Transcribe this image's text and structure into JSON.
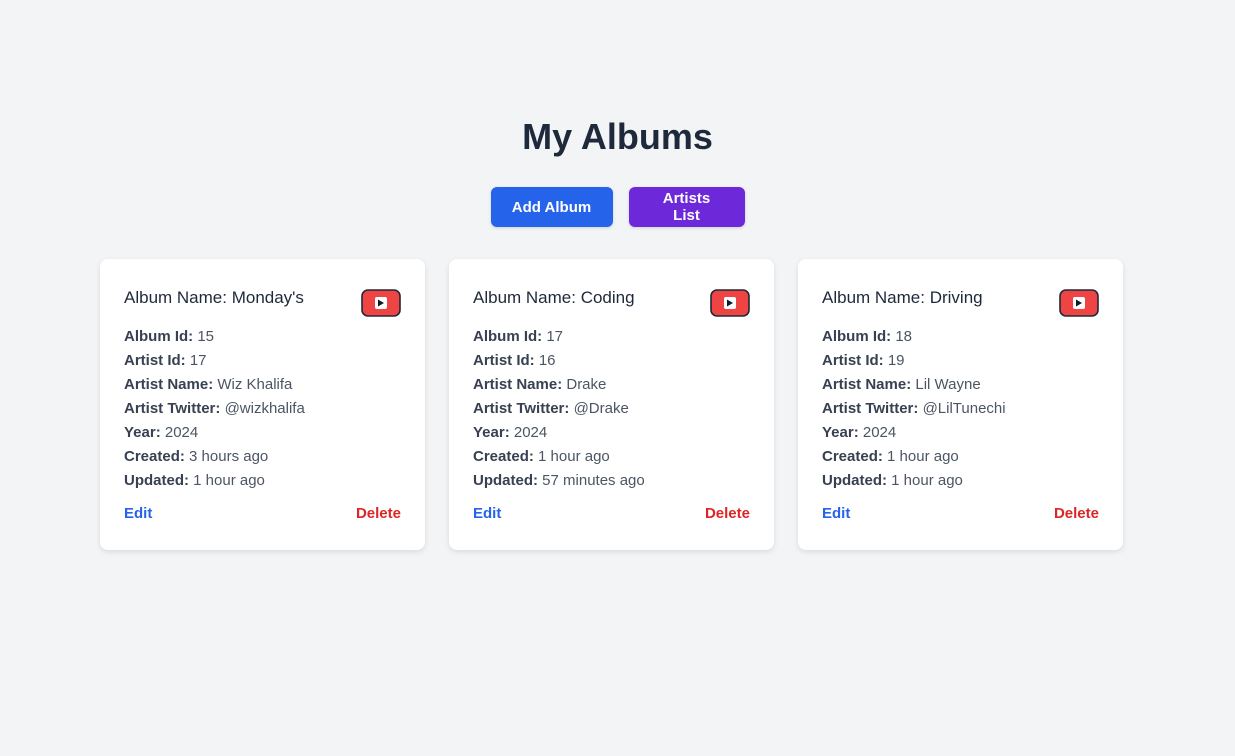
{
  "header": {
    "title": "My Albums",
    "add_album_label": "Add Album",
    "artists_list_label": "Artists List"
  },
  "labels": {
    "album_name": "Album Name: ",
    "album_id": "Album Id:",
    "artist_id": "Artist Id:",
    "artist_name": "Artist Name:",
    "artist_twitter": "Artist Twitter:",
    "year": "Year:",
    "created": "Created:",
    "updated": "Updated:",
    "edit": "Edit",
    "delete": "Delete"
  },
  "icons": {
    "play": "youtube-icon"
  },
  "colors": {
    "add_button": "#2563eb",
    "artists_button": "#6d28d9",
    "edit_link": "#2563eb",
    "delete_link": "#dc2626",
    "youtube_red": "#ef4444"
  },
  "albums": [
    {
      "name": "Monday's",
      "album_id": "15",
      "artist_id": "17",
      "artist_name": "Wiz Khalifa",
      "artist_twitter": "@wizkhalifa",
      "year": "2024",
      "created": "3 hours ago",
      "updated": "1 hour ago"
    },
    {
      "name": "Coding",
      "album_id": "17",
      "artist_id": "16",
      "artist_name": "Drake",
      "artist_twitter": "@Drake",
      "year": "2024",
      "created": "1 hour ago",
      "updated": "57 minutes ago"
    },
    {
      "name": "Driving",
      "album_id": "18",
      "artist_id": "19",
      "artist_name": "Lil Wayne",
      "artist_twitter": "@LilTunechi",
      "year": "2024",
      "created": "1 hour ago",
      "updated": "1 hour ago"
    }
  ]
}
